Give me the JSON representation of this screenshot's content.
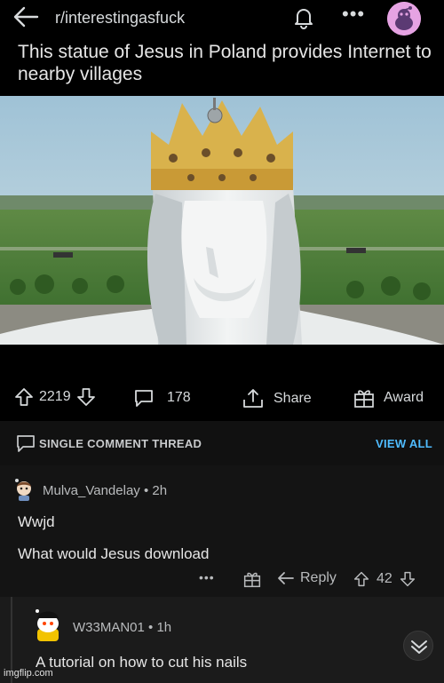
{
  "header": {
    "subreddit": "r/interestingasfuck",
    "more": "•••"
  },
  "post": {
    "title": "This statue of Jesus in Poland provides Internet to nearby villages",
    "upvotes": "2219",
    "comments": "178",
    "share_label": "Share",
    "award_label": "Award"
  },
  "thread": {
    "label": "SINGLE COMMENT THREAD",
    "view_all": "VIEW ALL"
  },
  "comment1": {
    "user": "Mulva_Vandelay",
    "time": "• 2h",
    "line1": "Wwjd",
    "line2": "What would Jesus download",
    "more": "•••",
    "reply_label": "Reply",
    "votes": "42"
  },
  "comment2": {
    "user": "W33MAN01",
    "time": "• 1h",
    "text": "A tutorial on how to cut his nails"
  },
  "watermark": "imgflip.com",
  "colors": {
    "background": "#000000",
    "text": "#d7dadc",
    "link_blue": "#4fbcff",
    "avatar_pink": "#e6a3e3"
  }
}
